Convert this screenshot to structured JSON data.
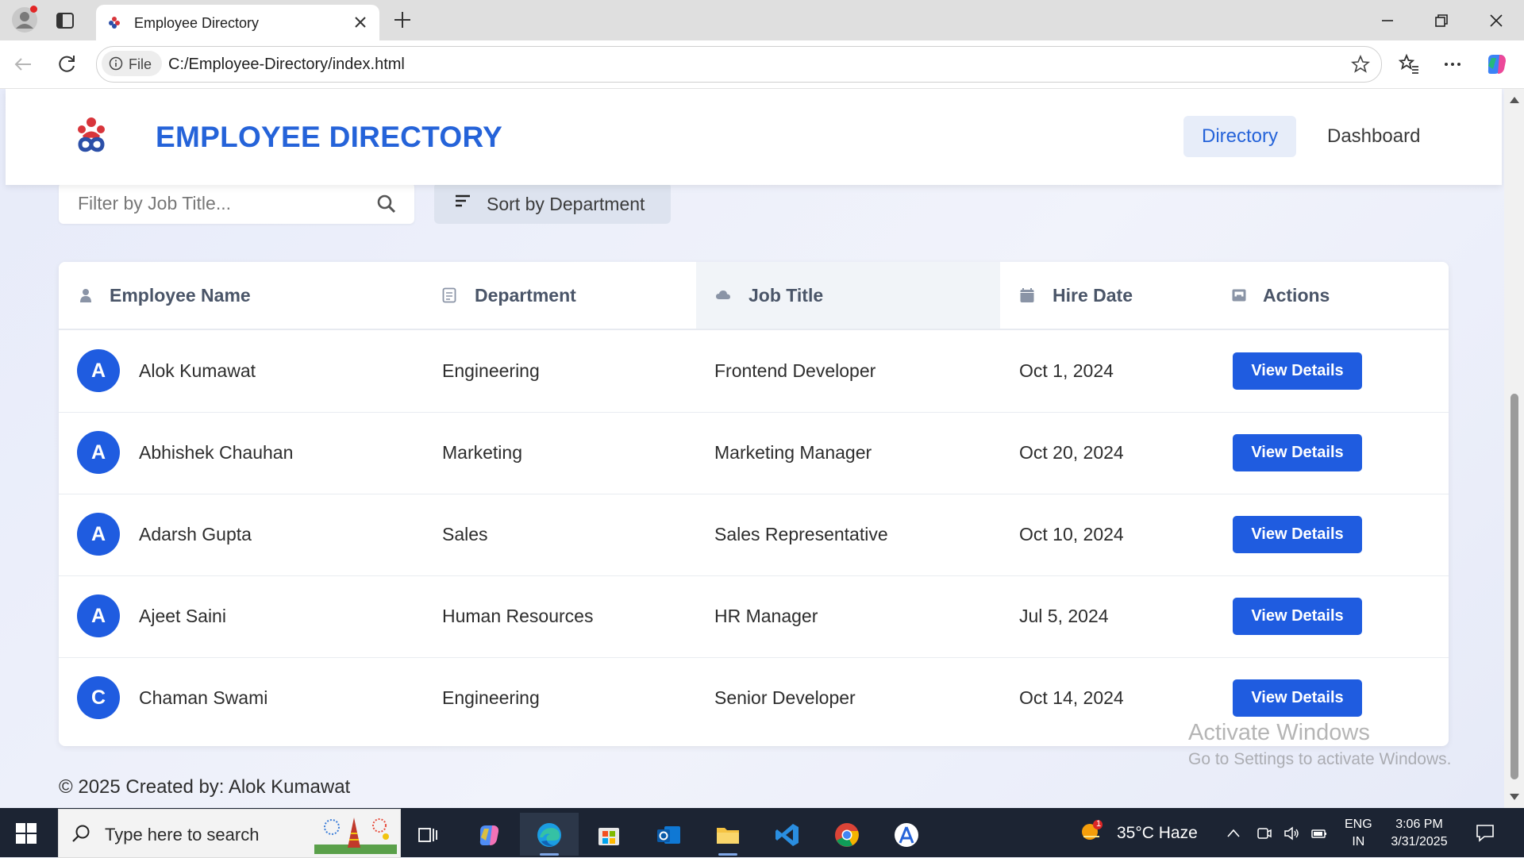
{
  "browser": {
    "tab_title": "Employee Directory",
    "file_label": "File",
    "url": "C:/Employee-Directory/index.html"
  },
  "header": {
    "title": "EMPLOYEE DIRECTORY",
    "nav": [
      {
        "label": "Directory",
        "active": true
      },
      {
        "label": "Dashboard",
        "active": false
      }
    ]
  },
  "controls": {
    "filter_placeholder": "Filter by Job Title...",
    "sort_label": "Sort by Department"
  },
  "table": {
    "columns": [
      {
        "label": "Employee Name",
        "icon": "person-icon"
      },
      {
        "label": "Department",
        "icon": "document-icon"
      },
      {
        "label": "Job Title",
        "icon": "cloud-icon"
      },
      {
        "label": "Hire Date",
        "icon": "calendar-icon"
      },
      {
        "label": "Actions",
        "icon": "inbox-icon"
      }
    ],
    "rows": [
      {
        "initial": "A",
        "name": "Alok Kumawat",
        "department": "Engineering",
        "job_title": "Frontend Developer",
        "hire_date": "Oct 1, 2024",
        "action": "View Details"
      },
      {
        "initial": "A",
        "name": "Abhishek Chauhan",
        "department": "Marketing",
        "job_title": "Marketing Manager",
        "hire_date": "Oct 20, 2024",
        "action": "View Details"
      },
      {
        "initial": "A",
        "name": "Adarsh Gupta",
        "department": "Sales",
        "job_title": "Sales Representative",
        "hire_date": "Oct 10, 2024",
        "action": "View Details"
      },
      {
        "initial": "A",
        "name": "Ajeet Saini",
        "department": "Human Resources",
        "job_title": "HR Manager",
        "hire_date": "Jul 5, 2024",
        "action": "View Details"
      },
      {
        "initial": "C",
        "name": "Chaman Swami",
        "department": "Engineering",
        "job_title": "Senior Developer",
        "hire_date": "Oct 14, 2024",
        "action": "View Details"
      }
    ]
  },
  "footer": "© 2025 Created by: Alok Kumawat",
  "watermark": {
    "line1": "Activate Windows",
    "line2": "Go to Settings to activate Windows."
  },
  "taskbar": {
    "search_placeholder": "Type here to search",
    "weather": "35°C  Haze",
    "weather_badge": "1",
    "lang_line1": "ENG",
    "lang_line2": "IN",
    "time": "3:06 PM",
    "date": "3/31/2025"
  },
  "colors": {
    "brand_blue": "#2563d9",
    "button_blue": "#1f5ce0",
    "active_nav_bg": "#e7edf9"
  }
}
